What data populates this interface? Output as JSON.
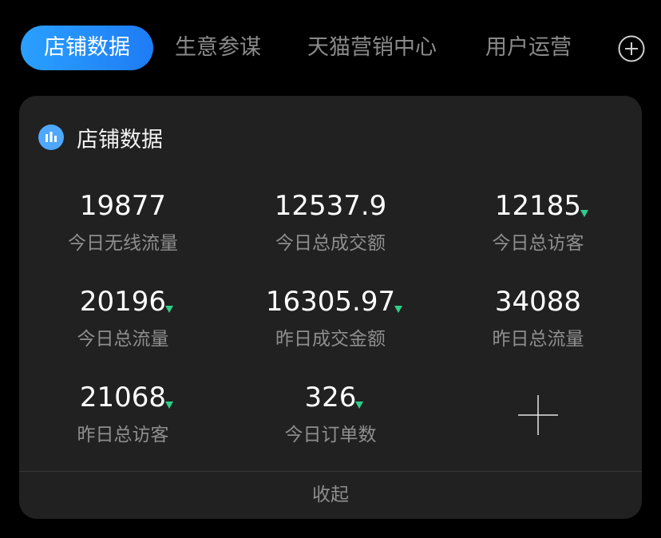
{
  "tabs": [
    {
      "label": "店铺数据",
      "active": true
    },
    {
      "label": "生意参谋",
      "active": false
    },
    {
      "label": "天猫营销中心",
      "active": false
    },
    {
      "label": "用户运营",
      "active": false
    }
  ],
  "tab_add_icon": "plus-circle-icon",
  "card": {
    "icon": "bar-chart-icon",
    "title": "店铺数据",
    "metrics": [
      {
        "value": "19877",
        "label": "今日无线流量",
        "trend": "none"
      },
      {
        "value": "12537.9",
        "label": "今日总成交额",
        "trend": "none"
      },
      {
        "value": "12185",
        "label": "今日总访客",
        "trend": "down"
      },
      {
        "value": "20196",
        "label": "今日总流量",
        "trend": "down"
      },
      {
        "value": "16305.97",
        "label": "昨日成交金额",
        "trend": "down"
      },
      {
        "value": "34088",
        "label": "昨日总流量",
        "trend": "none"
      },
      {
        "value": "21068",
        "label": "昨日总访客",
        "trend": "down"
      },
      {
        "value": "326",
        "label": "今日订单数",
        "trend": "down"
      }
    ],
    "add_metric_icon": "plus-icon",
    "collapse_label": "收起"
  },
  "colors": {
    "accent": "#1e90ff",
    "trend_down": "#2ecf8a",
    "background": "#000000",
    "card_bg": "#212121"
  }
}
